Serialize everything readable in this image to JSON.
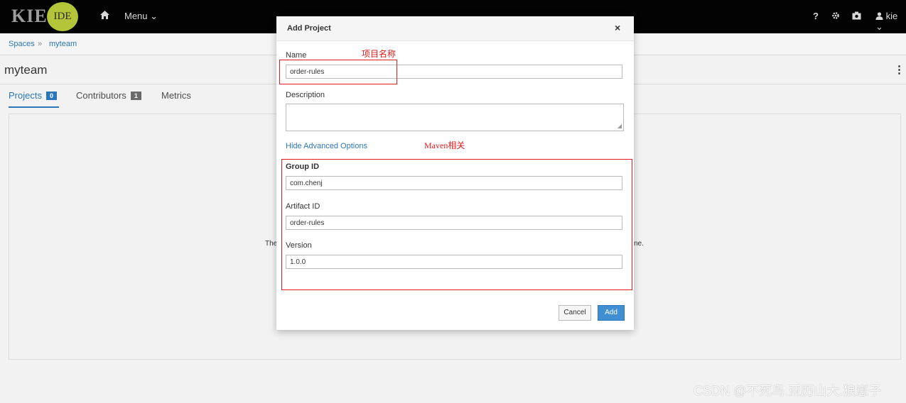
{
  "topbar": {
    "logo_text": "KIE",
    "logo_badge": "IDE",
    "home_icon": "home-icon",
    "menu_label": "Menu",
    "menu_chevron": "⌄",
    "help_label": "?",
    "settings_icon": "gear-icon",
    "camera_icon": "camera-icon",
    "user_label": "kie"
  },
  "breadcrumb": {
    "root": "Spaces",
    "separator": "»",
    "current": "myteam"
  },
  "page": {
    "title": "myteam",
    "kebab": "⋮"
  },
  "tabs": [
    {
      "label": "Projects",
      "count": "0"
    },
    {
      "label": "Contributors",
      "count": "1"
    },
    {
      "label": "Metrics"
    }
  ],
  "background_text": {
    "left_fragment": "The",
    "right_fragment": "ne."
  },
  "modal": {
    "title": "Add Project",
    "close": "×",
    "name_label": "Name",
    "name_value": "order-rules",
    "description_label": "Description",
    "description_value": "",
    "advanced_link": "Hide Advanced Options",
    "group_label": "Group ID",
    "group_value": "com.chenj",
    "artifact_label": "Artifact ID",
    "artifact_value": "order-rules",
    "version_label": "Version",
    "version_value": "1.0.0",
    "cancel_label": "Cancel",
    "add_label": "Add"
  },
  "annotations": {
    "name_note": "项目名称",
    "maven_note": "Maven相关",
    "color": "#e31b1b"
  },
  "watermark": "CSDN @不死鸟.亚历山大.狼崽子",
  "colors": {
    "accent": "#2b76b9",
    "primary_button": "#3f8fd2",
    "topbar": "#030303",
    "logo_badge": "#b4c53a"
  }
}
